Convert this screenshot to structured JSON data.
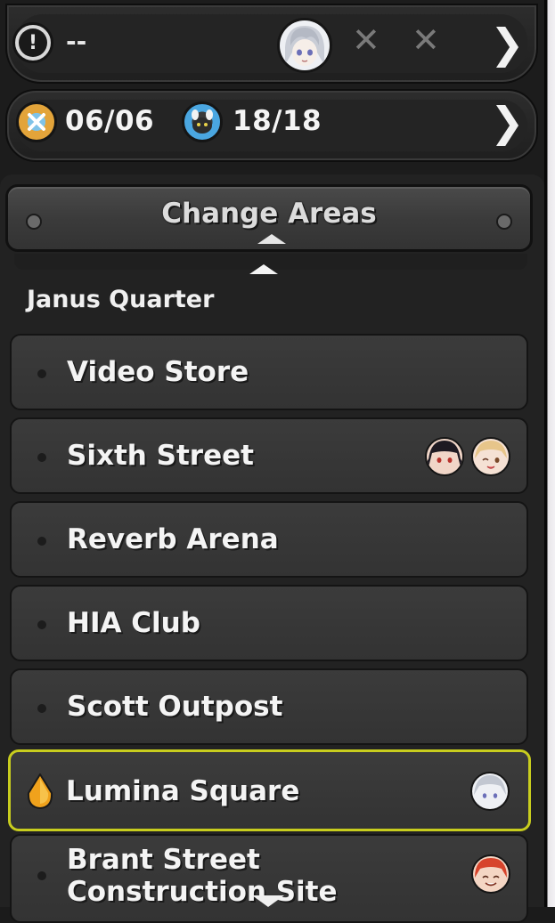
{
  "status_bar": {
    "alert_text": "--",
    "party_slots": [
      "filled",
      "empty",
      "empty"
    ],
    "empty_slot_glyph": "✕",
    "next_glyph": "❯"
  },
  "resources": {
    "stamina": {
      "icon": "stamina-badge-icon",
      "value": "06/06"
    },
    "bangboo": {
      "icon": "bangboo-icon",
      "value": "18/18"
    },
    "next_glyph": "❯"
  },
  "change_areas": {
    "label": "Change Areas"
  },
  "group": {
    "title": "Janus Quarter"
  },
  "locations": [
    {
      "label": "Video Store",
      "avatars": [],
      "active": false
    },
    {
      "label": "Sixth Street",
      "avatars": [
        "dark-hair-agent-avatar",
        "blonde-agent-avatar"
      ],
      "active": false
    },
    {
      "label": "Reverb Arena",
      "avatars": [],
      "active": false
    },
    {
      "label": "HIA Club",
      "avatars": [],
      "active": false
    },
    {
      "label": "Scott Outpost",
      "avatars": [],
      "active": false
    },
    {
      "label": "Lumina Square",
      "avatars": [
        "silver-hair-agent-avatar"
      ],
      "active": true
    },
    {
      "label_line1": "Brant Street",
      "label_line2": "Construction Site",
      "avatars": [
        "red-hair-agent-avatar"
      ],
      "active": false
    }
  ],
  "colors": {
    "active_border": "#c8cd1e",
    "panel": "#1c1c1c",
    "row": "#383838"
  }
}
